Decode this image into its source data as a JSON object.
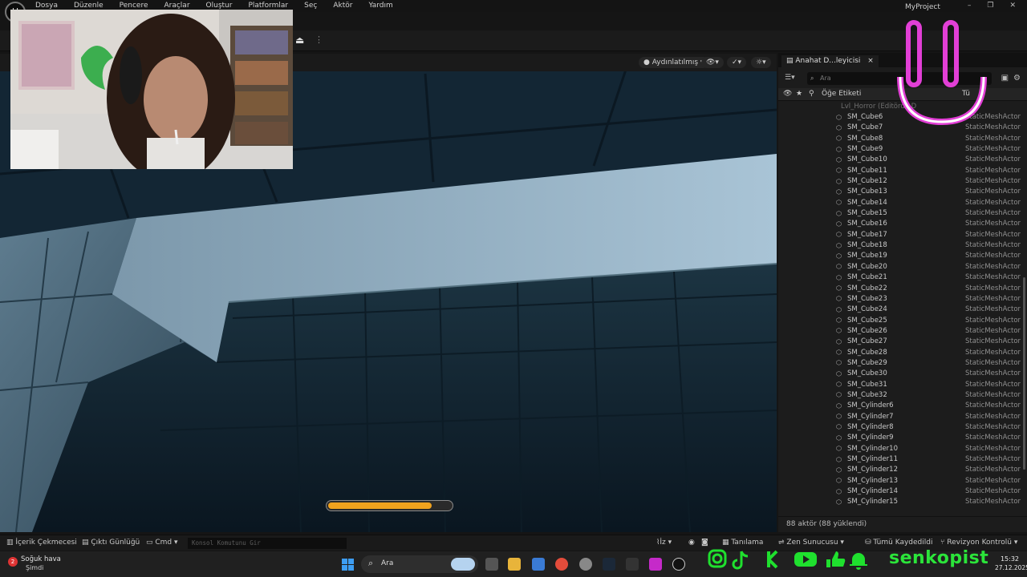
{
  "menubar": {
    "logo_glyph": "U",
    "items": [
      "Dosya",
      "Düzenle",
      "Pencere",
      "Araçlar",
      "Oluştur",
      "Platformlar",
      "Seç",
      "Aktör",
      "Yardım"
    ],
    "project_name": "MyProject",
    "window_controls": [
      "–",
      "❐",
      "✕"
    ]
  },
  "viewport": {
    "lighting_label": "Aydınlatılmış",
    "streaming_progress": 0.84
  },
  "outliner": {
    "tab_label": "Anahat D...leyicisi",
    "tab_close": "×",
    "search_placeholder": "Ara",
    "column_label": "Öğe Etiketi",
    "column_type": "Tü",
    "partial_row": "Lvl_Horror (Editörde D",
    "rows": [
      {
        "name": "SM_Cube6",
        "type": "StaticMeshActor"
      },
      {
        "name": "SM_Cube7",
        "type": "StaticMeshActor"
      },
      {
        "name": "SM_Cube8",
        "type": "StaticMeshActor"
      },
      {
        "name": "SM_Cube9",
        "type": "StaticMeshActor"
      },
      {
        "name": "SM_Cube10",
        "type": "StaticMeshActor"
      },
      {
        "name": "SM_Cube11",
        "type": "StaticMeshActor"
      },
      {
        "name": "SM_Cube12",
        "type": "StaticMeshActor"
      },
      {
        "name": "SM_Cube13",
        "type": "StaticMeshActor"
      },
      {
        "name": "SM_Cube14",
        "type": "StaticMeshActor"
      },
      {
        "name": "SM_Cube15",
        "type": "StaticMeshActor"
      },
      {
        "name": "SM_Cube16",
        "type": "StaticMeshActor"
      },
      {
        "name": "SM_Cube17",
        "type": "StaticMeshActor"
      },
      {
        "name": "SM_Cube18",
        "type": "StaticMeshActor"
      },
      {
        "name": "SM_Cube19",
        "type": "StaticMeshActor"
      },
      {
        "name": "SM_Cube20",
        "type": "StaticMeshActor"
      },
      {
        "name": "SM_Cube21",
        "type": "StaticMeshActor"
      },
      {
        "name": "SM_Cube22",
        "type": "StaticMeshActor"
      },
      {
        "name": "SM_Cube23",
        "type": "StaticMeshActor"
      },
      {
        "name": "SM_Cube24",
        "type": "StaticMeshActor"
      },
      {
        "name": "SM_Cube25",
        "type": "StaticMeshActor"
      },
      {
        "name": "SM_Cube26",
        "type": "StaticMeshActor"
      },
      {
        "name": "SM_Cube27",
        "type": "StaticMeshActor"
      },
      {
        "name": "SM_Cube28",
        "type": "StaticMeshActor"
      },
      {
        "name": "SM_Cube29",
        "type": "StaticMeshActor"
      },
      {
        "name": "SM_Cube30",
        "type": "StaticMeshActor"
      },
      {
        "name": "SM_Cube31",
        "type": "StaticMeshActor"
      },
      {
        "name": "SM_Cube32",
        "type": "StaticMeshActor"
      },
      {
        "name": "SM_Cylinder6",
        "type": "StaticMeshActor"
      },
      {
        "name": "SM_Cylinder7",
        "type": "StaticMeshActor"
      },
      {
        "name": "SM_Cylinder8",
        "type": "StaticMeshActor"
      },
      {
        "name": "SM_Cylinder9",
        "type": "StaticMeshActor"
      },
      {
        "name": "SM_Cylinder10",
        "type": "StaticMeshActor"
      },
      {
        "name": "SM_Cylinder11",
        "type": "StaticMeshActor"
      },
      {
        "name": "SM_Cylinder12",
        "type": "StaticMeshActor"
      },
      {
        "name": "SM_Cylinder13",
        "type": "StaticMeshActor"
      },
      {
        "name": "SM_Cylinder14",
        "type": "StaticMeshActor"
      },
      {
        "name": "SM_Cylinder15",
        "type": "StaticMeshActor"
      }
    ],
    "footer": "88 aktör (88 yüklendi)"
  },
  "statusbar": {
    "content_drawer": "İçerik Çekmecesi",
    "output_log": "Çıktı Günlüğü",
    "cmd": "Cmd",
    "console_placeholder": "Konsol Komutunu Gir",
    "trace": "İz",
    "derived_data": "Tanılama",
    "zen_server": "Zen Sunucusu",
    "all_saved": "Tümü Kaydedildi",
    "revision_control": "Revizyon Kontrolü"
  },
  "taskbar": {
    "weather_title": "Soğuk hava",
    "weather_subtitle": "Şimdi",
    "weather_badge": "2",
    "search_label": "Ara",
    "social_handle": "senkopist",
    "time": "15:32",
    "date": "27.12.2025"
  },
  "colors": {
    "social_green": "#1fe02e",
    "smiley_pink": "#e23fd6",
    "progress_orange": "#f0a21e"
  }
}
